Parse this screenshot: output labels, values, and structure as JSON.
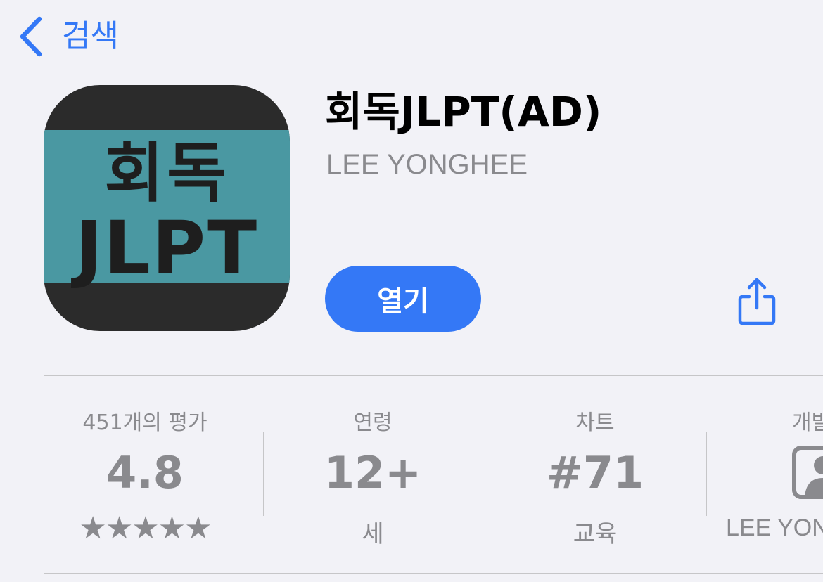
{
  "nav": {
    "back_label": "검색"
  },
  "app": {
    "icon_line1": "회독",
    "icon_line2": "JLPT",
    "title": "회독JLPT(AD)",
    "developer": "LEE YONGHEE",
    "open_label": "열기"
  },
  "colors": {
    "accent": "#3478f6",
    "icon_band": "#4a98a2",
    "icon_dark": "#2b2b2b",
    "secondary_text": "#8a8a8e"
  },
  "stats": {
    "ratings": {
      "label": "451개의 평가",
      "value": "4.8",
      "stars": "★★★★★",
      "star_count": 5
    },
    "age": {
      "label": "연령",
      "value": "12+",
      "sub": "세"
    },
    "chart": {
      "label": "차트",
      "value": "#71",
      "sub": "교육"
    },
    "developer": {
      "label": "개발",
      "icon": "person-icon",
      "sub": "LEE YON"
    }
  }
}
